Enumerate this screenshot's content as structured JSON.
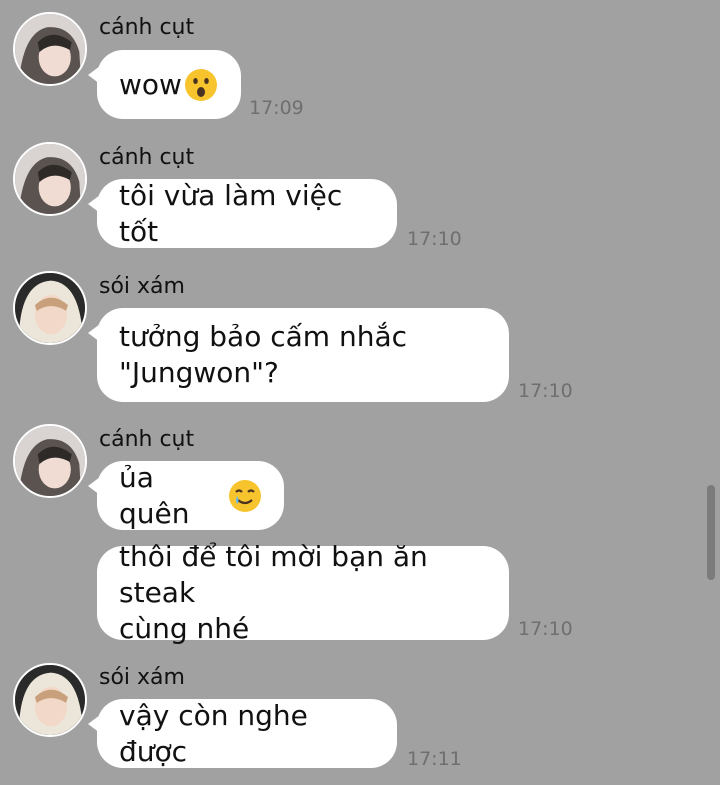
{
  "colors": {
    "background": "#a1a1a1",
    "bubble": "#ffffff",
    "timestamp": "#6f6f6f"
  },
  "messages": [
    {
      "sender": "cánh cụt",
      "text": "wow",
      "emoji": "astonished-face",
      "time": "17:09"
    },
    {
      "sender": "cánh cụt",
      "text": "tôi vừa làm việc tốt",
      "time": "17:10"
    },
    {
      "sender": "sói xám",
      "text": "tưởng bảo cấm nhắc\n\"Jungwon\"?",
      "time": "17:10"
    },
    {
      "sender": "cánh cụt",
      "text": "ủa quên",
      "emoji": "smiling-face-with-tear"
    },
    {
      "text": "thôi để tôi mời bạn ăn steak\ncùng nhé",
      "time": "17:10"
    },
    {
      "sender": "sói xám",
      "text": "vậy còn nghe được",
      "time": "17:11"
    }
  ]
}
